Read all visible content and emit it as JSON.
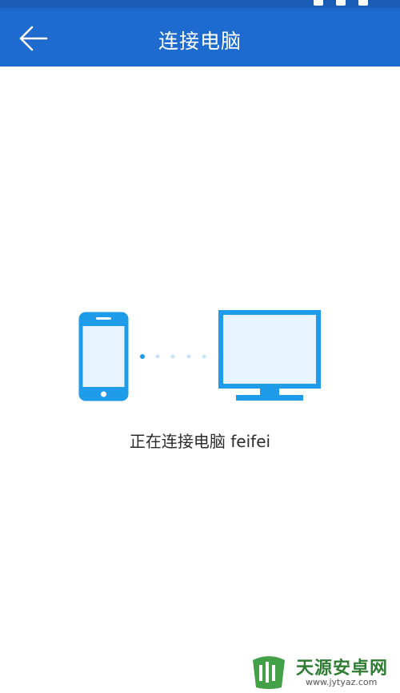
{
  "header": {
    "title": "连接电脑"
  },
  "status": {
    "message": "正在连接电脑 feifei"
  },
  "watermark": {
    "brand": "天源安卓网",
    "url": "www.jytyaz.com"
  },
  "colors": {
    "app_bar": "#1e6bd0",
    "accent": "#1e9be9",
    "device_fill": "#e8f4fd"
  },
  "icons": {
    "back": "arrow-left-icon",
    "phone": "smartphone-icon",
    "monitor": "monitor-icon"
  }
}
